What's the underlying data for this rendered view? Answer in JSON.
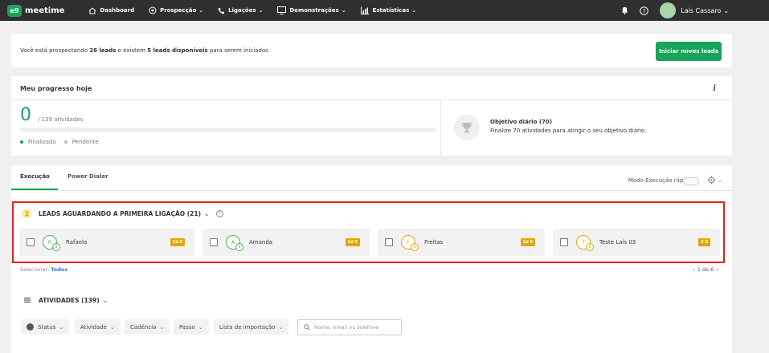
{
  "nav": {
    "logo_badge": "e9",
    "logo_text": "meetime",
    "items": [
      {
        "label": "Dashboard"
      },
      {
        "label": "Prospecção",
        "caret": "⌄"
      },
      {
        "label": "Ligações",
        "caret": "⌄"
      },
      {
        "label": "Demonstrações",
        "caret": "⌄"
      },
      {
        "label": "Estatísticas",
        "caret": "⌄"
      }
    ],
    "user": "Laís Cassaro",
    "user_caret": "⌄",
    "help": "?"
  },
  "prospect": {
    "pre": "Você está prospectando ",
    "leads_count": "26 leads",
    "mid": " e existem ",
    "available": "5 leads disponíveis",
    "post": " para serem iniciados",
    "button": "Iniciar novos leads"
  },
  "progress": {
    "title": "Meu progresso hoje",
    "info": "i",
    "done": "0",
    "total": "/ 139 atividades",
    "fraction_done": 0,
    "legend_done": "Finalizado",
    "legend_pending": "Pendente",
    "goal_title": "Objetivo diário (70)",
    "goal_desc": "Finalize 70 atividades para atingir o seu objetivo diário."
  },
  "exec": {
    "tabs": [
      "Execução",
      "Power Dialer"
    ],
    "fast_mode": "Modo Execução rápida",
    "gear_caret": "⌄"
  },
  "leads": {
    "title": "LEADS AGUARDANDO A PRIMEIRA LIGAÇÃO (21)",
    "caret": "⌄",
    "help": "?",
    "cards": [
      {
        "initial": "R",
        "step": "9",
        "name": "Rafaela",
        "badge": "1d 0",
        "color": "#4caf50"
      },
      {
        "initial": "A",
        "step": "9",
        "name": "Amanda",
        "badge": "2d 0",
        "color": "#4caf50"
      },
      {
        "initial": "F",
        "step": "8",
        "name": "Freitas",
        "badge": "2d 0",
        "color": "#e0a800"
      },
      {
        "initial": "T",
        "step": "8",
        "name": "Teste Laís 03",
        "badge": "3 0",
        "color": "#e0a800"
      }
    ],
    "select_label": "Selecionar:",
    "select_all": "Todos",
    "pager_prev": "‹",
    "pager": "1 de 6",
    "pager_next": "›"
  },
  "activities": {
    "title": "ATIVIDADES (139)",
    "caret": "⌄",
    "filters": [
      "Status",
      "Atividade",
      "Cadência",
      "Passo",
      "Lista de importação"
    ],
    "filter_caret": "⌄",
    "search_placeholder": "Nome, email ou telefone"
  },
  "colors": {
    "brand": "#1aa35a",
    "highlight_border": "#e02020",
    "badge": "#e0a800",
    "link": "#2a7ac9"
  }
}
